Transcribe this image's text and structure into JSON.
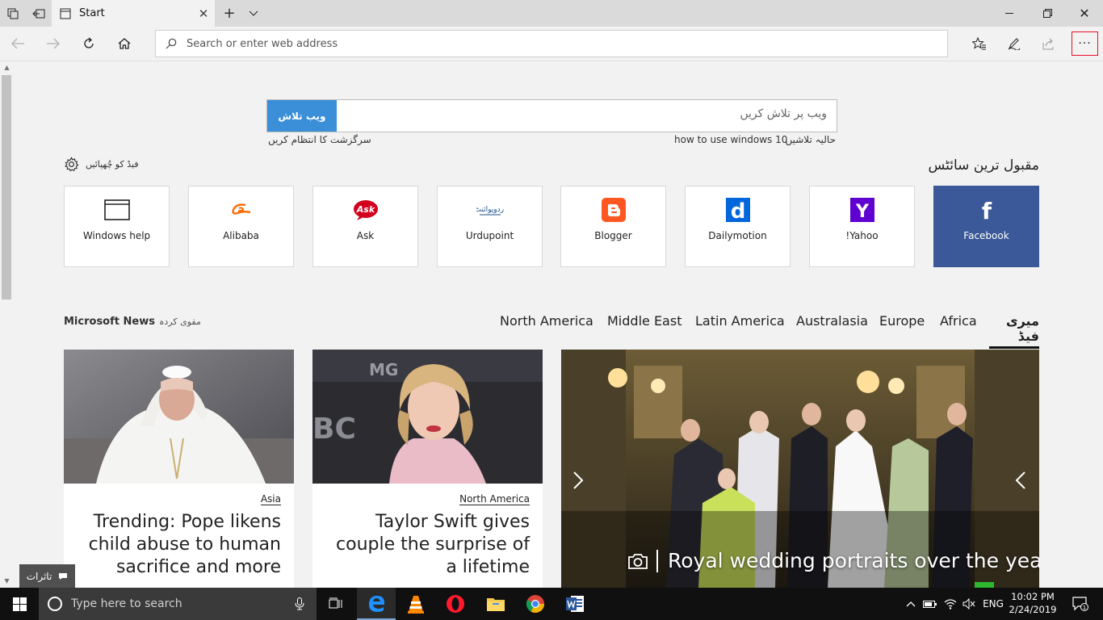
{
  "browser": {
    "tab_title": "Start",
    "address_placeholder": "Search or enter web address"
  },
  "search": {
    "button_label": "ویب تلاش",
    "placeholder": "ویب پر تلاش کریں",
    "manage_history": "سرگزشت کا انتظام کریں",
    "recent_query": "how to use windows 10",
    "recent_label": "حالیہ تلاشیں"
  },
  "feed_settings_label": "فیڈ کو چُھپائیں",
  "top_sites": {
    "title": "مقبول ترین سائٹس",
    "items": [
      {
        "label": "Windows help",
        "icon": "window-icon"
      },
      {
        "label": "Alibaba",
        "icon": "alibaba-logo-icon"
      },
      {
        "label": "Ask",
        "icon": "ask-logo-icon",
        "logo_text": "Ask"
      },
      {
        "label": "Urdupoint",
        "icon": "urdupoint-logo-icon",
        "logo_text": "اردوپوائنٹ"
      },
      {
        "label": "Blogger",
        "icon": "blogger-logo-icon"
      },
      {
        "label": "Dailymotion",
        "icon": "dailymotion-logo-icon",
        "logo_text": "d"
      },
      {
        "label": "Yahoo!",
        "icon": "yahoo-logo-icon",
        "logo_text": "Y"
      },
      {
        "label": "Facebook",
        "icon": "facebook-logo-icon",
        "logo_text": "f"
      }
    ]
  },
  "news": {
    "brand": "Microsoft News",
    "powered_by": "مقوی کردہ",
    "tabs": [
      "North America",
      "Middle East",
      "Latin America",
      "Australasia",
      "Europe",
      "Africa",
      "میری فیڈ"
    ],
    "active_tab": "میری فیڈ",
    "cards": [
      {
        "tag": "Asia",
        "headline": "Trending: Pope likens child abuse to human sacrifice and more"
      },
      {
        "tag": "North America",
        "headline": "Taylor Swift gives couple the surprise of a lifetime"
      }
    ],
    "hero": {
      "headline": "Royal wedding portraits over the years"
    }
  },
  "feedback_label": "تاثرات",
  "taskbar": {
    "search_placeholder": "Type here to search",
    "language": "ENG",
    "time": "10:02 PM",
    "date": "2/24/2019",
    "notification_count": "1"
  },
  "colors": {
    "search_button": "#3a8fd8",
    "facebook": "#3b5998",
    "more_button_border": "#e81123"
  }
}
